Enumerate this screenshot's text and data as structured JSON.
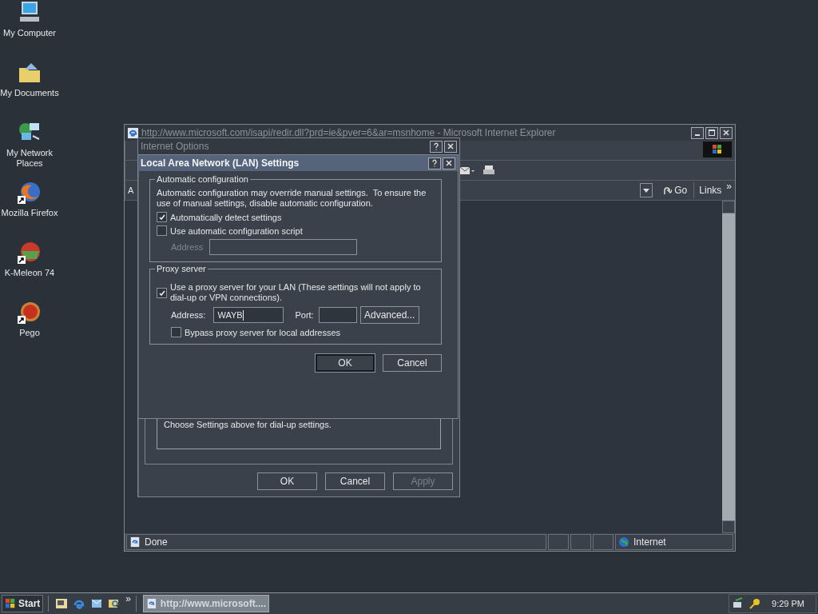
{
  "desktop_icons": [
    {
      "label": "My Computer",
      "kind": "computer",
      "shortcut": false
    },
    {
      "label": "My Documents",
      "kind": "documents",
      "shortcut": false
    },
    {
      "label": "My Network Places",
      "kind": "network",
      "shortcut": false
    },
    {
      "label": "Mozilla Firefox",
      "kind": "firefox",
      "shortcut": true
    },
    {
      "label": "K-Meleon 74",
      "kind": "kmeleon",
      "shortcut": true
    },
    {
      "label": "Pego",
      "kind": "pego",
      "shortcut": true
    }
  ],
  "browser": {
    "title": "http://www.microsoft.com/isapi/redir.dll?prd=ie&pver=6&ar=msnhome - Microsoft Internet Explorer",
    "active": false,
    "address_label": "A",
    "go": "Go",
    "links": "Links",
    "links_more": "»",
    "status": "Done",
    "zone": "Internet"
  },
  "internet_options": {
    "title": "Internet Options",
    "active": false,
    "note": "Choose Settings above for dial-up settings.",
    "buttons": [
      {
        "label": "OK",
        "disabled": false
      },
      {
        "label": "Cancel",
        "disabled": false
      },
      {
        "label": "Apply",
        "disabled": true
      }
    ]
  },
  "lan_dialog": {
    "title": "Local Area Network (LAN) Settings",
    "active": true,
    "auto_group": {
      "legend": "Automatic configuration",
      "description": "Automatic configuration may override manual settings.  To ensure the use of manual settings, disable automatic configuration.",
      "options": [
        {
          "label": "Automatically detect settings",
          "checked": true
        },
        {
          "label": "Use automatic configuration script",
          "checked": false
        }
      ],
      "script_address": {
        "label": "Address",
        "disabled": true
      }
    },
    "proxy_group": {
      "legend": "Proxy server",
      "use_proxy": {
        "label": "Use a proxy server for your LAN (These settings will not apply to dial-up or VPN connections).",
        "checked": true
      },
      "address_label": "Address:",
      "address_value": "WAYB",
      "port_label": "Port:",
      "advanced": "Advanced...",
      "bypass": {
        "label": "Bypass proxy server for local addresses",
        "checked": false
      }
    },
    "buttons": [
      {
        "label": "OK",
        "focused": true
      },
      {
        "label": "Cancel",
        "focused": false
      }
    ]
  },
  "taskbar": {
    "start": "Start",
    "more": "»",
    "task": "http://www.microsoft....",
    "clock": "9:29 PM"
  }
}
